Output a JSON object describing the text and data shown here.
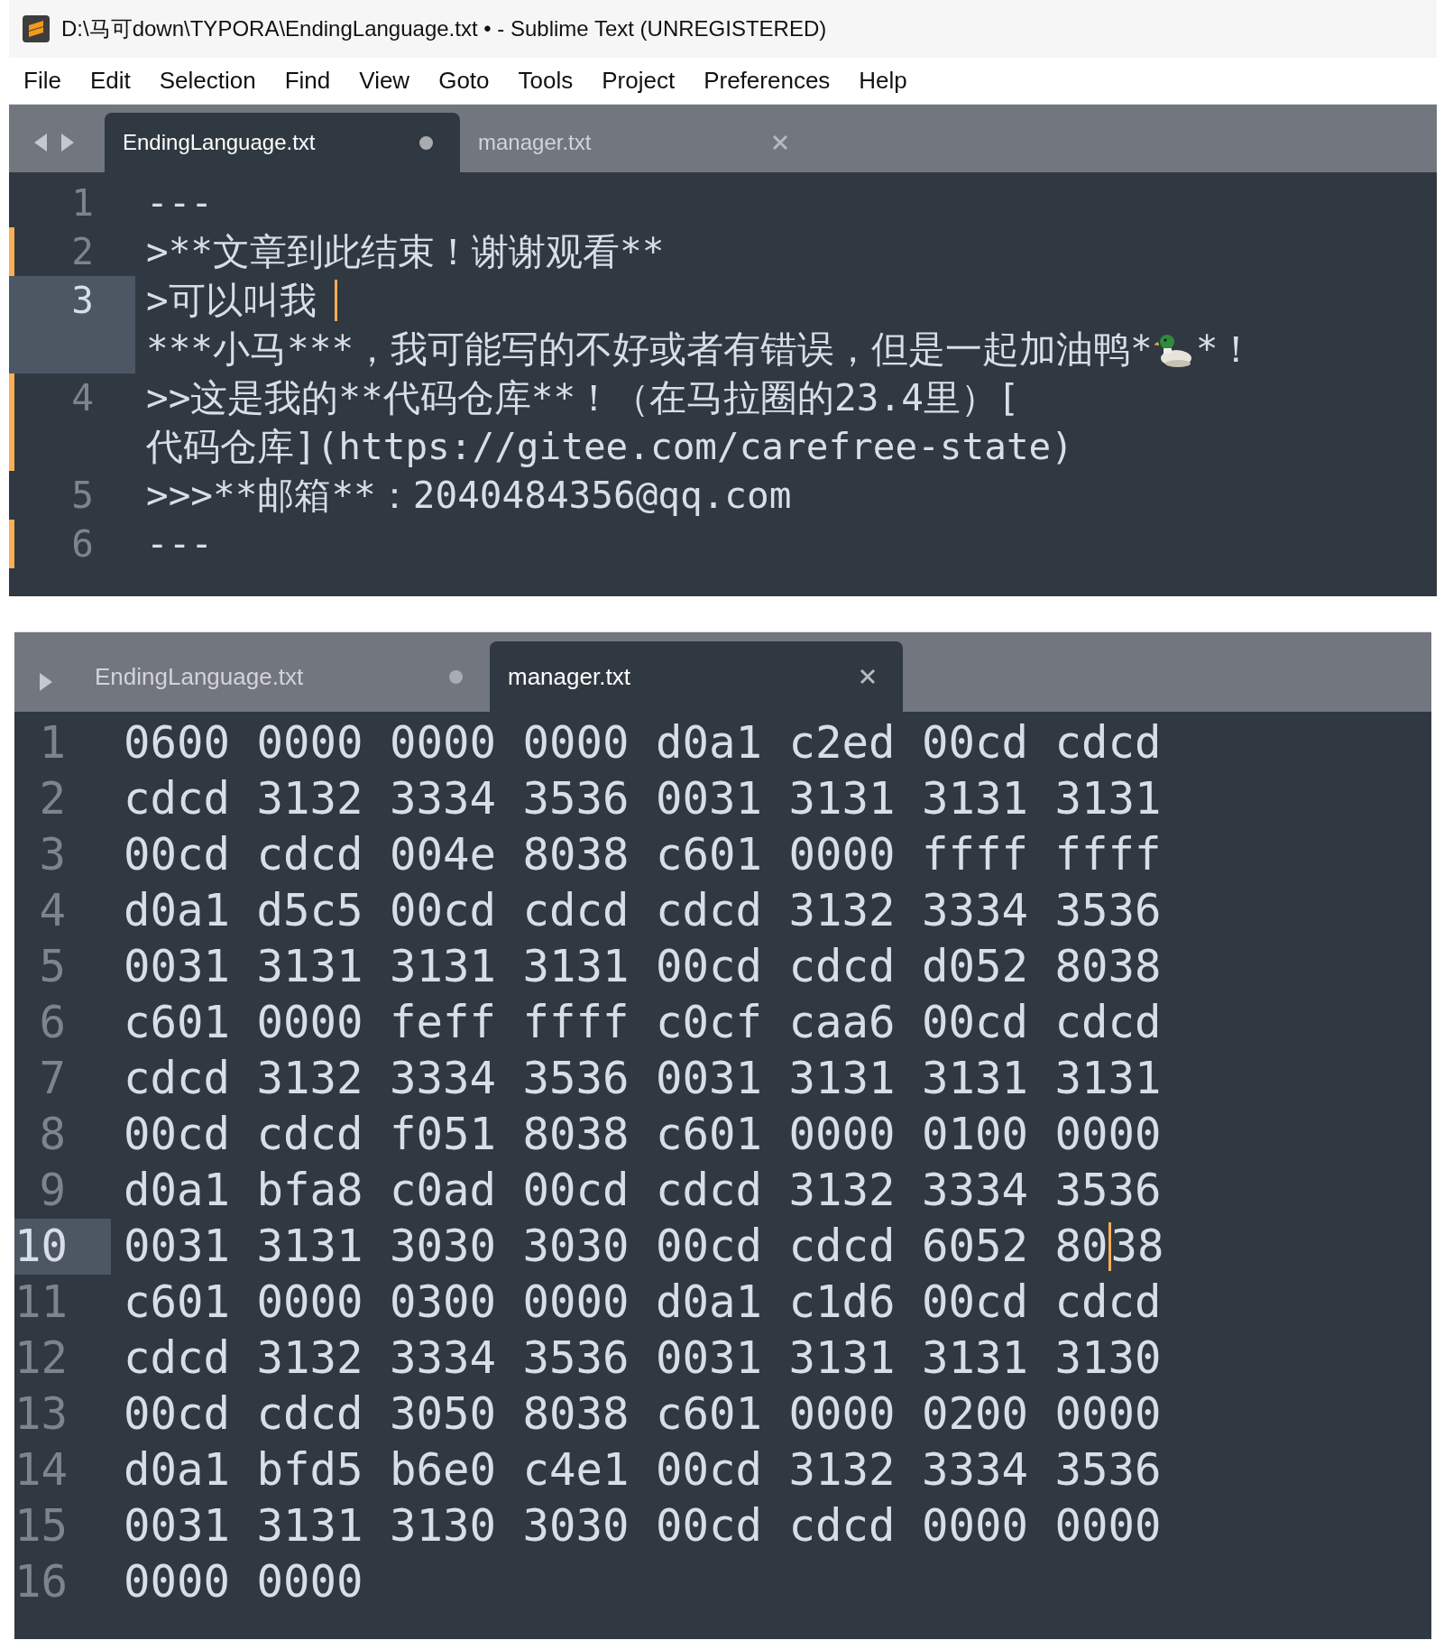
{
  "windows": [
    {
      "title": "D:\\马可down\\TYPORA\\EndingLanguage.txt • - Sublime Text (UNREGISTERED)",
      "menu": [
        "File",
        "Edit",
        "Selection",
        "Find",
        "View",
        "Goto",
        "Tools",
        "Project",
        "Preferences",
        "Help"
      ],
      "nav_arrows": [
        {
          "kind": "left"
        },
        {
          "kind": "right"
        }
      ],
      "tabs": [
        {
          "label": "EndingLanguage.txt",
          "selected": true,
          "modified": true
        },
        {
          "label": "manager.txt",
          "selected": false,
          "modified": false
        }
      ],
      "lines": [
        {
          "number": "1",
          "modified": false,
          "current": false,
          "rows": [
            {
              "text": "---"
            }
          ]
        },
        {
          "number": "2",
          "modified": true,
          "current": false,
          "rows": [
            {
              "text": ">**文章到此结束！谢谢观看**"
            }
          ]
        },
        {
          "number": "3",
          "modified": false,
          "current": true,
          "rows": [
            {
              "text": ">可以叫我",
              "caret": true
            },
            {
              "segments": [
                {
                  "kind": "text",
                  "text": "***小马***，我可能写的不好或者有错误，但是一起加油鸭*"
                },
                {
                  "kind": "emoji"
                },
                {
                  "kind": "text",
                  "text": "*！"
                }
              ]
            }
          ]
        },
        {
          "number": "4",
          "modified": true,
          "current": false,
          "rows": [
            {
              "text": ">>这是我的**代码仓库**！（在马拉圈的23.4里）["
            },
            {
              "text": "代码仓库](https://gitee.com/carefree-state)"
            }
          ]
        },
        {
          "number": "5",
          "modified": false,
          "current": false,
          "rows": [
            {
              "text": ">>>**邮箱**：2040484356@qq.com"
            }
          ]
        },
        {
          "number": "6",
          "modified": true,
          "current": false,
          "rows": [
            {
              "text": "---"
            }
          ]
        }
      ]
    },
    {
      "nav_arrows": [
        {
          "kind": "right"
        }
      ],
      "tabs": [
        {
          "label": "EndingLanguage.txt",
          "selected": false,
          "modified": true
        },
        {
          "label": "manager.txt",
          "selected": true,
          "modified": false
        }
      ],
      "lines": [
        {
          "number": "1",
          "modified": false,
          "current": false,
          "rows": [
            {
              "text": "0600 0000 0000 0000 d0a1 c2ed 00cd cdcd"
            }
          ]
        },
        {
          "number": "2",
          "modified": false,
          "current": false,
          "rows": [
            {
              "text": "cdcd 3132 3334 3536 0031 3131 3131 3131"
            }
          ]
        },
        {
          "number": "3",
          "modified": false,
          "current": false,
          "rows": [
            {
              "text": "00cd cdcd 004e 8038 c601 0000 ffff ffff"
            }
          ]
        },
        {
          "number": "4",
          "modified": false,
          "current": false,
          "rows": [
            {
              "text": "d0a1 d5c5 00cd cdcd cdcd 3132 3334 3536"
            }
          ]
        },
        {
          "number": "5",
          "modified": false,
          "current": false,
          "rows": [
            {
              "text": "0031 3131 3131 3131 00cd cdcd d052 8038"
            }
          ]
        },
        {
          "number": "6",
          "modified": false,
          "current": false,
          "rows": [
            {
              "text": "c601 0000 feff ffff c0cf caa6 00cd cdcd"
            }
          ]
        },
        {
          "number": "7",
          "modified": false,
          "current": false,
          "rows": [
            {
              "text": "cdcd 3132 3334 3536 0031 3131 3131 3131"
            }
          ]
        },
        {
          "number": "8",
          "modified": false,
          "current": false,
          "rows": [
            {
              "text": "00cd cdcd f051 8038 c601 0000 0100 0000"
            }
          ]
        },
        {
          "number": "9",
          "modified": false,
          "current": false,
          "rows": [
            {
              "text": "d0a1 bfa8 c0ad 00cd cdcd 3132 3334 3536"
            }
          ]
        },
        {
          "number": "10",
          "modified": false,
          "current": true,
          "rows": [
            {
              "text": "0031 3131 3030 3030 00cd cdcd 6052 80",
              "caret": true,
              "after_caret": "38"
            }
          ]
        },
        {
          "number": "11",
          "modified": false,
          "current": false,
          "rows": [
            {
              "text": "c601 0000 0300 0000 d0a1 c1d6 00cd cdcd"
            }
          ]
        },
        {
          "number": "12",
          "modified": false,
          "current": false,
          "rows": [
            {
              "text": "cdcd 3132 3334 3536 0031 3131 3131 3130"
            }
          ]
        },
        {
          "number": "13",
          "modified": false,
          "current": false,
          "rows": [
            {
              "text": "00cd cdcd 3050 8038 c601 0000 0200 0000"
            }
          ]
        },
        {
          "number": "14",
          "modified": false,
          "current": false,
          "rows": [
            {
              "text": "d0a1 bfd5 b6e0 c4e1 00cd 3132 3334 3536"
            }
          ]
        },
        {
          "number": "15",
          "modified": false,
          "current": false,
          "rows": [
            {
              "text": "0031 3131 3130 3030 00cd cdcd 0000 0000"
            }
          ]
        },
        {
          "number": "16",
          "modified": false,
          "current": false,
          "rows": [
            {
              "text": "0000 0000"
            }
          ]
        }
      ]
    }
  ]
}
